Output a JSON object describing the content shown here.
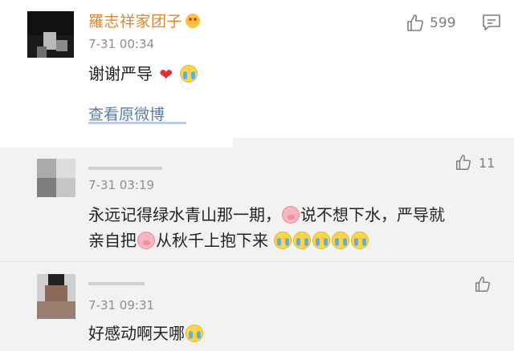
{
  "comments": [
    {
      "username": "羅志祥家团子",
      "time": "7-31 00:34",
      "text": "谢谢严导",
      "likes": "599",
      "view_original": "查看原微博"
    },
    {
      "time": "7-31 03:19",
      "line1": "永远记得绿水青山那一期，",
      "line1b": "说不想下水，严导就",
      "line2a": "亲自把",
      "line2b": "从秋千上抱下来",
      "likes": "11"
    },
    {
      "time": "7-31 09:31",
      "text": "好感动啊天哪"
    }
  ],
  "icons": {
    "like": "thumbs-up-icon",
    "comment": "comment-icon",
    "vip": "vip-badge-icon",
    "heart": "heart-emoji",
    "cry": "crying-emoji",
    "pig": "pig-emoji"
  },
  "colors": {
    "username": "#e5862b",
    "link": "#5b7da8",
    "heart": "#e3302f",
    "band_bg": "#f2f2f2"
  }
}
